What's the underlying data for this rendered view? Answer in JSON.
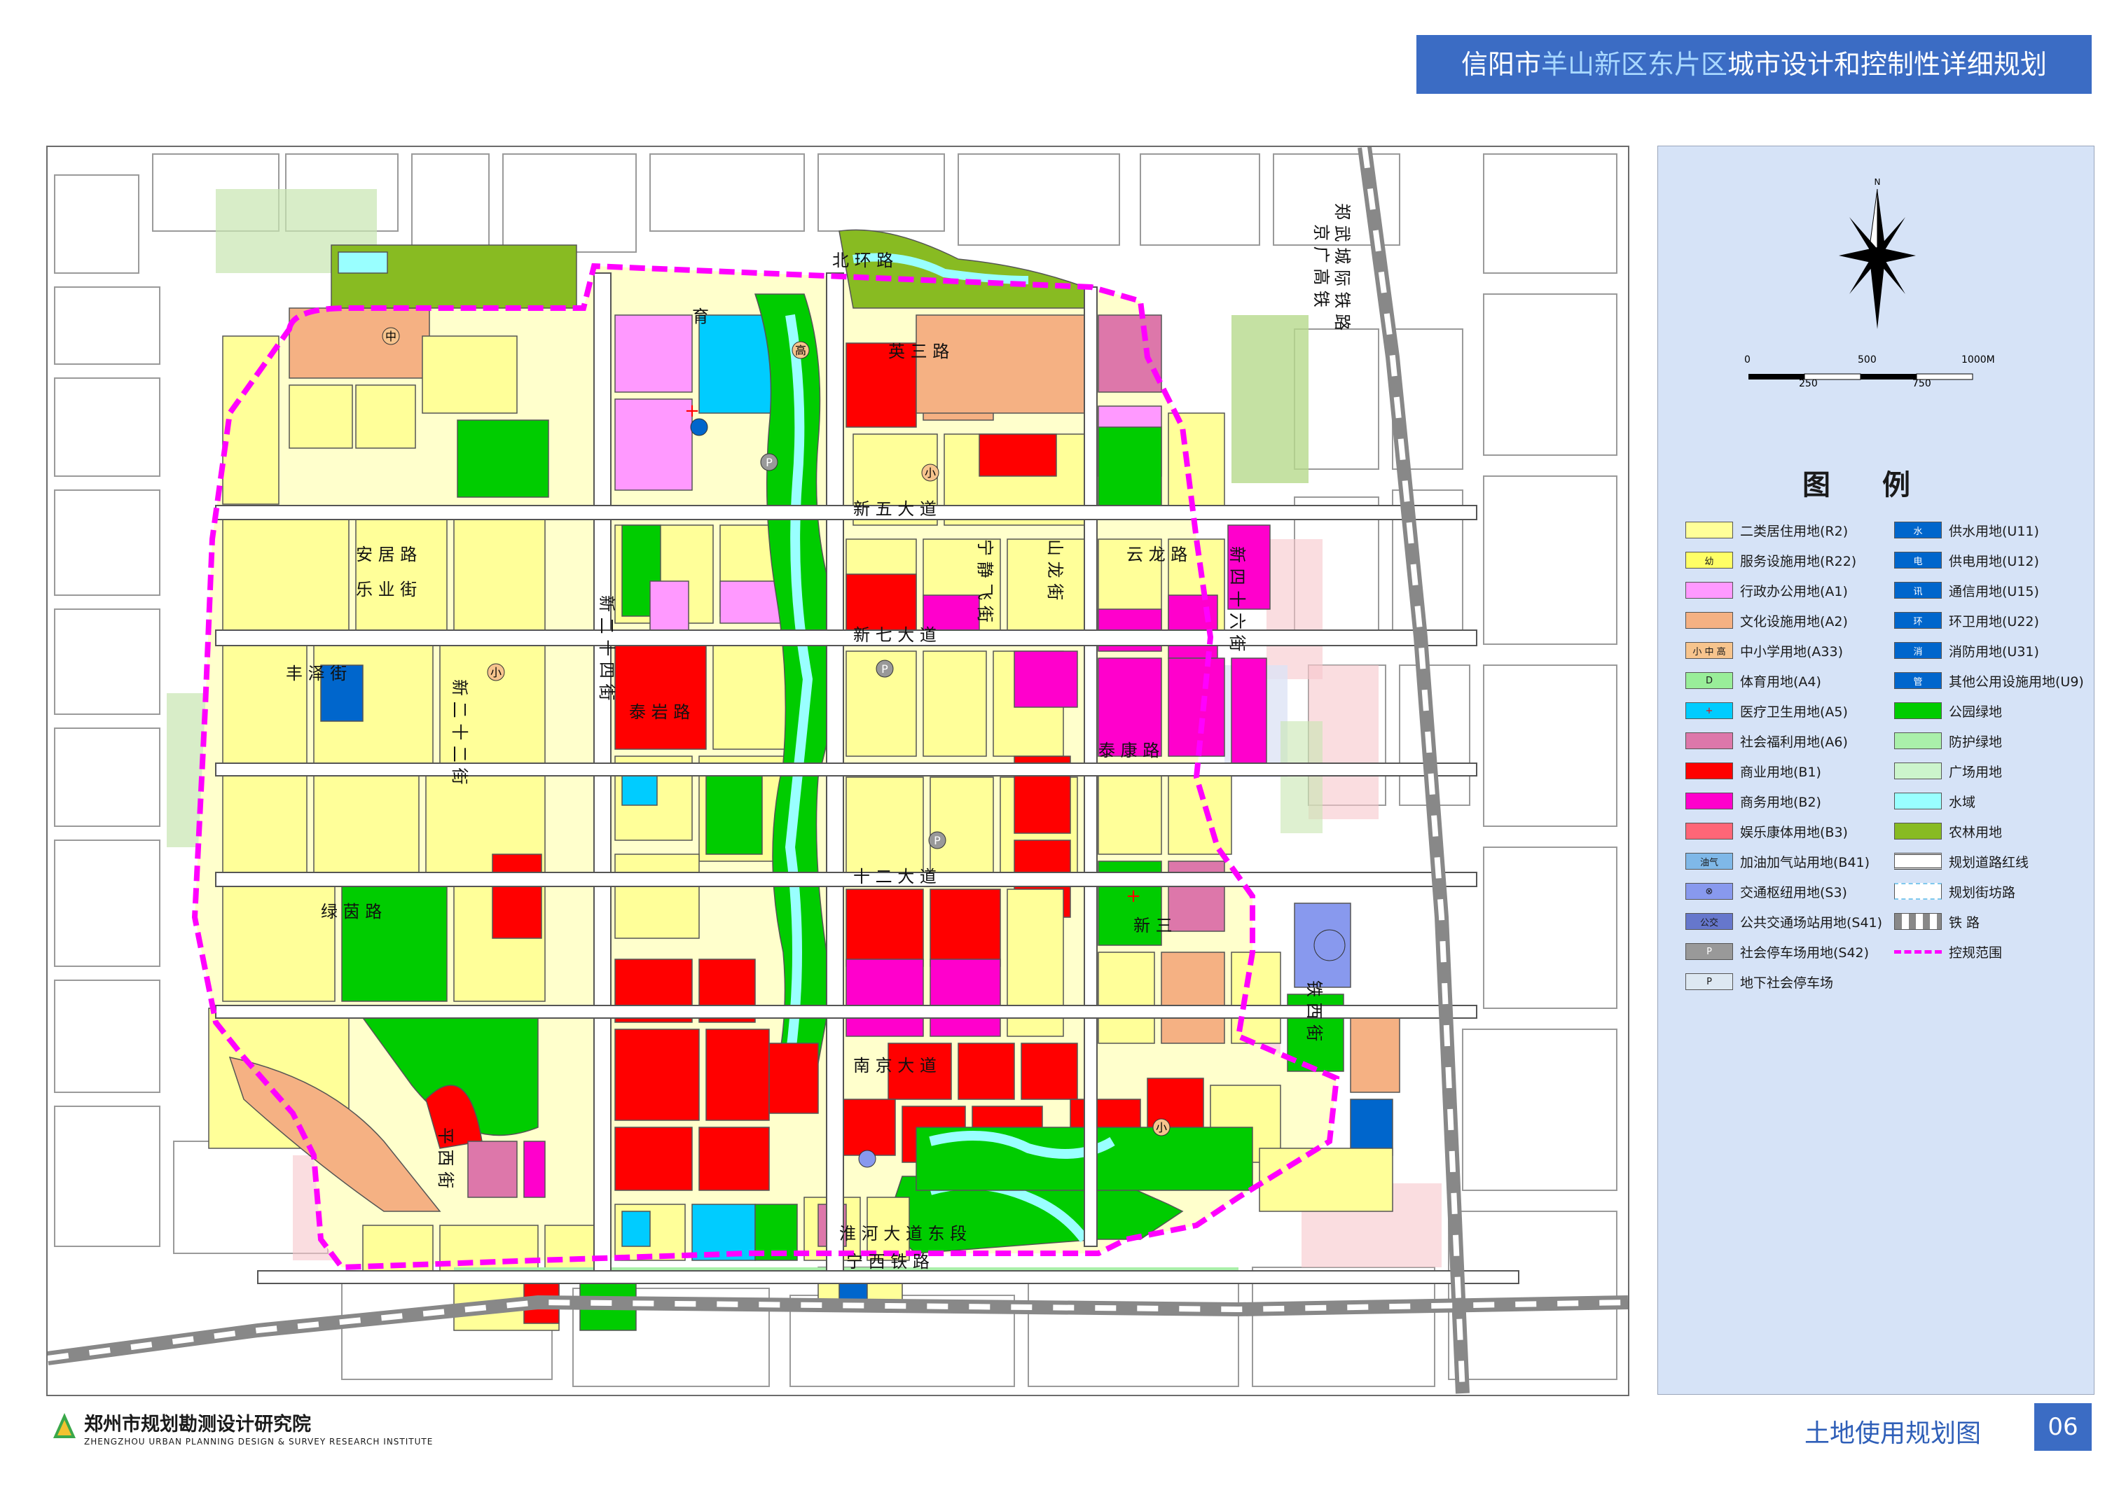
{
  "header": {
    "title_part1": "信阳市",
    "title_highlight": "羊山新区东片区",
    "title_part2": "城市设计和控制性详细规划"
  },
  "colors": {
    "residential_r2": "#ffff99",
    "service_r22": "#ffff66",
    "admin_a1": "#ff99ff",
    "culture_a2": "#f5b183",
    "school_a33": "#f7c48d",
    "sports_a4": "#99ee99",
    "medical_a5": "#00ccff",
    "welfare_a6": "#dd77aa",
    "commercial_b1": "#ff0000",
    "business_b2": "#ff00cc",
    "entertainment_b3": "#ff6677",
    "gas_station_b41": "#7fb8e8",
    "transport_hub_s3": "#8899ee",
    "bus_station_s41": "#6677cc",
    "parking_s42": "#999999",
    "underground_parking": "#dde8f2",
    "water_u11": "#0066cc",
    "power_u12": "#0066cc",
    "telecom_u15": "#0066cc",
    "sanitation_u22": "#0066cc",
    "fire_u31": "#0066cc",
    "other_utility_u9": "#0066cc",
    "park_green": "#00cc00",
    "buffer_green": "#aaf0aa",
    "plaza": "#ccf5cc",
    "water": "#99ffff",
    "farmland": "#88bb22",
    "boundary": "#ff00ff"
  },
  "compass": {
    "north_label": "N"
  },
  "scale_bar": {
    "top_labels": [
      "0",
      "500",
      "1000M"
    ],
    "bottom_labels": [
      "250",
      "750"
    ]
  },
  "legend": {
    "title": "图 例",
    "left_items": [
      {
        "label": "二类居住用地(R2)",
        "symbol": ""
      },
      {
        "label": "服务设施用地(R22)",
        "symbol": "幼"
      },
      {
        "label": "行政办公用地(A1)",
        "symbol": ""
      },
      {
        "label": "文化设施用地(A2)",
        "symbol": ""
      },
      {
        "label": "中小学用地(A33)",
        "symbol": "小 中 高"
      },
      {
        "label": "体育用地(A4)",
        "symbol": "D"
      },
      {
        "label": "医疗卫生用地(A5)",
        "symbol": "+"
      },
      {
        "label": "社会福利用地(A6)",
        "symbol": ""
      },
      {
        "label": "商业用地(B1)",
        "symbol": ""
      },
      {
        "label": "商务用地(B2)",
        "symbol": ""
      },
      {
        "label": "娱乐康体用地(B3)",
        "symbol": ""
      },
      {
        "label": "加油加气站用地(B41)",
        "symbol": "油气"
      },
      {
        "label": "交通枢纽用地(S3)",
        "symbol": "⊗"
      },
      {
        "label": "公共交通场站用地(S41)",
        "symbol": "公交"
      },
      {
        "label": "社会停车场用地(S42)",
        "symbol": "P"
      },
      {
        "label": "地下社会停车场",
        "symbol": "P"
      }
    ],
    "right_items": [
      {
        "label": "供水用地(U11)",
        "symbol": "水"
      },
      {
        "label": "供电用地(U12)",
        "symbol": "电"
      },
      {
        "label": "通信用地(U15)",
        "symbol": "讯"
      },
      {
        "label": "环卫用地(U22)",
        "symbol": "环"
      },
      {
        "label": "消防用地(U31)",
        "symbol": "消"
      },
      {
        "label": "其他公用设施用地(U9)",
        "symbol": "管"
      },
      {
        "label": "公园绿地",
        "symbol": ""
      },
      {
        "label": "防护绿地",
        "symbol": ""
      },
      {
        "label": "广场用地",
        "symbol": ""
      },
      {
        "label": "水域",
        "symbol": ""
      },
      {
        "label": "农林用地",
        "symbol": ""
      },
      {
        "label": "规划道路红线",
        "symbol": ""
      },
      {
        "label": "规划街坊路",
        "symbol": ""
      },
      {
        "label": "铁 路",
        "symbol": ""
      },
      {
        "label": "控规范围",
        "symbol": ""
      }
    ]
  },
  "road_labels": {
    "beihuan": "北 环 路",
    "yu": "育",
    "yingsanlu": "英 三 路",
    "xinwu": "新 五 大 道",
    "xinqi": "新 七 大 道",
    "xinshi": "十 二 大 道",
    "xinfen": "新 二 十 四 街",
    "xinsan": "新 三",
    "nanjing": "南 京 大 道",
    "huaihe": "淮 河 大 道 东 段",
    "ningxi": "宁 西 铁 路",
    "anju": "安 居 路",
    "leye": "乐 业 街",
    "taiyan": "泰 岩 路",
    "taikang": "泰 康 路",
    "yunlong": "云 龙 路",
    "lvyin": "绿 茵 路",
    "pingxi": "平 西 街",
    "tiexi": "铁 西 街",
    "jingfei": "宁 静 飞 街",
    "shanlong": "山 龙 街",
    "xinsiliu": "新 四 十 六 街",
    "zhengwu": "郑 武 城 际 铁 路",
    "jinguang": "京 广 高 铁",
    "fengze": "丰 泽 街",
    "xinershi": "新 二 十 二 街"
  },
  "footer": {
    "org_cn": "郑州市规划勘测设计研究院",
    "org_en": "ZHENGZHOU URBAN PLANNING DESIGN & SURVEY RESEARCH INSTITUTE",
    "map_name": "土地使用规划图",
    "page_number": "06"
  }
}
